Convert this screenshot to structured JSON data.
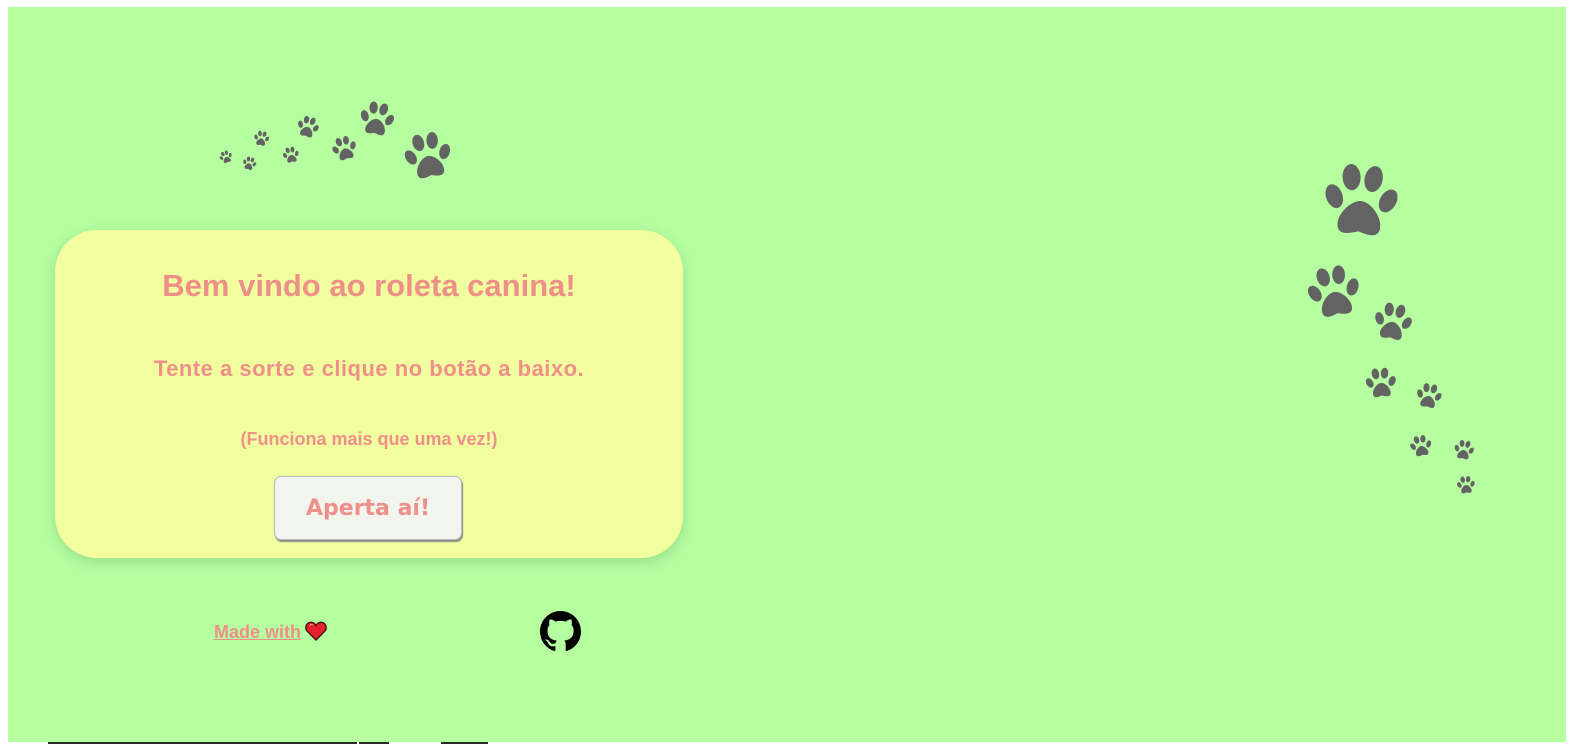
{
  "colors": {
    "background": "#b5ffa1",
    "card": "#f1ff9e",
    "text_accent": "#ef8f89",
    "paw": "#636363",
    "button": "#f2f5ee"
  },
  "card": {
    "title": "Bem vindo ao roleta canina!",
    "subtitle": "Tente a sorte e clique no botão a baixo.",
    "note": "(Funciona mais que uma vez!)",
    "button_label": "Aperta aí!"
  },
  "footer": {
    "made_with_label": "Made with",
    "made_with_icon": "heart-icon",
    "github_icon": "github-icon"
  },
  "decor": {
    "paw_icon": "paw-print-icon"
  }
}
